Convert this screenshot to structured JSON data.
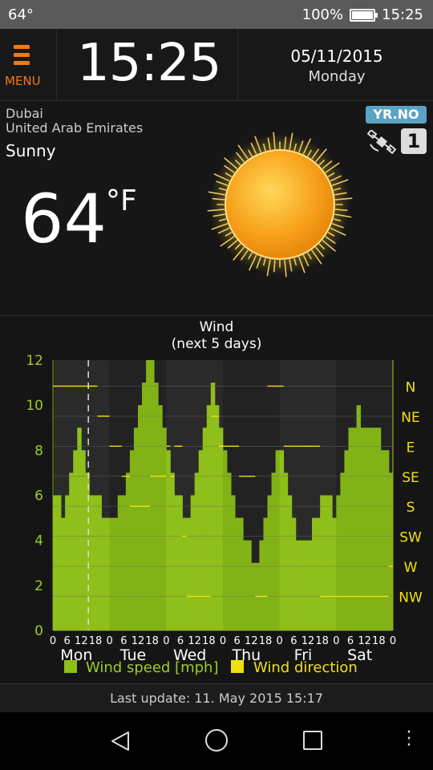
{
  "status": {
    "temperature": "64°",
    "battery": "100%",
    "time": "15:25",
    "battery_level": 1.0
  },
  "header": {
    "menu_label": "MENU",
    "time": "15:25",
    "date": "05/11/2015",
    "weekday": "Monday"
  },
  "current": {
    "city": "Dubai",
    "country": "United Arab Emirates",
    "condition": "Sunny",
    "temperature": "64",
    "unit": "°F",
    "provider": "YR.NO",
    "source_badge": "1",
    "icon": "sun-icon"
  },
  "chart_data": {
    "type": "bar",
    "title": "Wind",
    "subtitle": "(next 5 days)",
    "x_hour_ticks": [
      "0",
      "6",
      "12",
      "18",
      "0",
      "6",
      "12",
      "18",
      "0",
      "6",
      "12",
      "18",
      "0",
      "6",
      "12",
      "18",
      "0",
      "6",
      "12",
      "18",
      "0",
      "6",
      "12",
      "18",
      "0"
    ],
    "days": [
      "Mon",
      "Tue",
      "Wed",
      "Thu",
      "Fri",
      "Sat"
    ],
    "ylim": [
      0,
      12
    ],
    "y_ticks": [
      "0",
      "2",
      "4",
      "6",
      "8",
      "10",
      "12"
    ],
    "right_ticks": [
      "N",
      "NE",
      "E",
      "SE",
      "S",
      "SW",
      "W",
      "NW"
    ],
    "current_hour": 15,
    "series": [
      {
        "name": "Wind speed [mph]",
        "color": "#8fbf1a",
        "values": [
          6,
          6,
          5,
          6,
          7,
          8,
          9,
          8,
          7,
          6,
          6,
          6,
          5,
          5,
          5,
          5,
          6,
          6,
          7,
          8,
          9,
          10,
          11,
          12,
          12,
          11,
          10,
          9,
          8,
          7,
          6,
          6,
          5,
          5,
          6,
          7,
          8,
          9,
          10,
          11,
          10,
          9,
          8,
          7,
          6,
          5,
          5,
          4,
          4,
          3,
          3,
          4,
          5,
          6,
          7,
          8,
          8,
          7,
          6,
          5,
          4,
          4,
          4,
          4,
          5,
          5,
          6,
          6,
          6,
          5,
          6,
          7,
          8,
          9,
          9,
          10,
          9,
          9,
          9,
          9,
          9,
          8,
          8,
          7
        ]
      },
      {
        "name": "Wind direction",
        "color": "#f0e010",
        "values": [
          0,
          0,
          0,
          0,
          0,
          0,
          0,
          0,
          0,
          0,
          0,
          1,
          1,
          1,
          2,
          2,
          2,
          3,
          3,
          4,
          4,
          4,
          4,
          4,
          3,
          3,
          3,
          3,
          2,
          3,
          2,
          2,
          5,
          7,
          7,
          7,
          7,
          7,
          7,
          1,
          1,
          2,
          2,
          2,
          2,
          2,
          3,
          3,
          3,
          3,
          7,
          7,
          7,
          0,
          0,
          0,
          0,
          2,
          2,
          2,
          2,
          2,
          2,
          2,
          2,
          2,
          7,
          7,
          7,
          7,
          7,
          7,
          7,
          7,
          7,
          7,
          7,
          7,
          7,
          7,
          7,
          7,
          7,
          6
        ]
      }
    ],
    "legend": "bottom"
  },
  "footer": {
    "last_update": "Last update: 11. May 2015  15:17"
  }
}
